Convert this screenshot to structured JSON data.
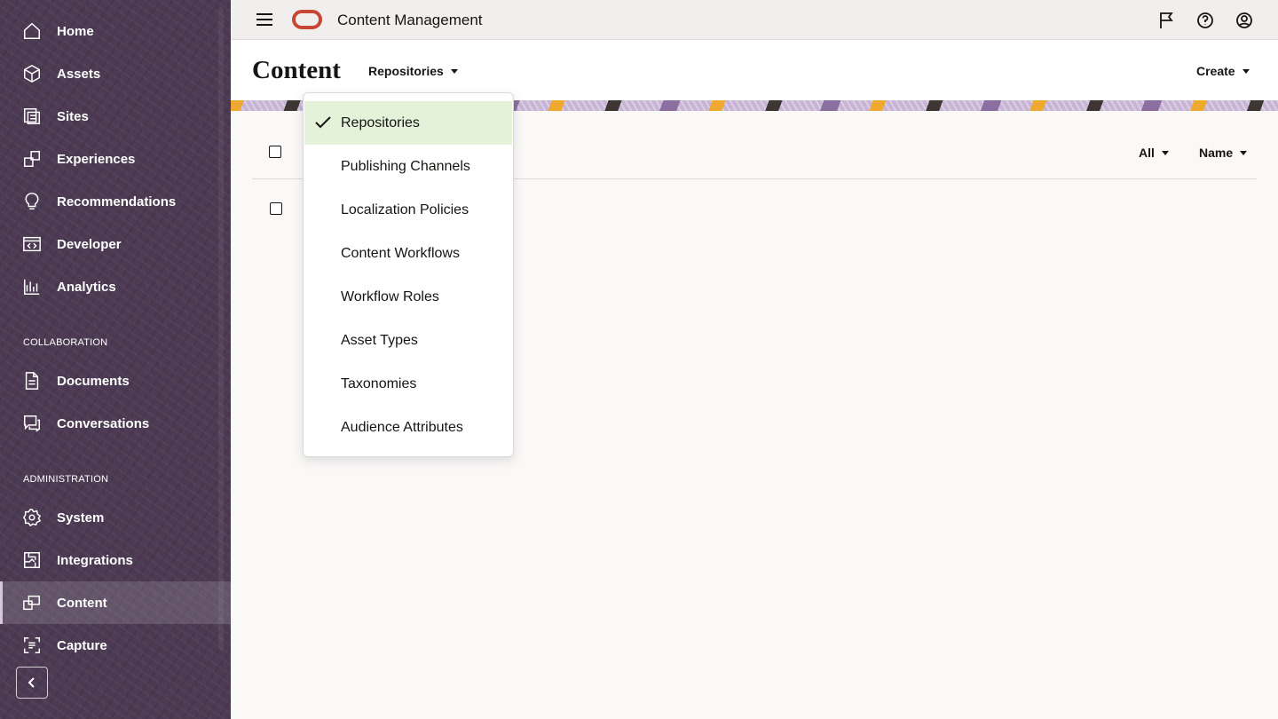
{
  "app": {
    "title": "Content Management"
  },
  "sidebar": {
    "items": [
      {
        "label": "Home",
        "icon": "home-icon"
      },
      {
        "label": "Assets",
        "icon": "cube-icon"
      },
      {
        "label": "Sites",
        "icon": "sites-icon"
      },
      {
        "label": "Experiences",
        "icon": "experiences-icon"
      },
      {
        "label": "Recommendations",
        "icon": "lightbulb-icon"
      },
      {
        "label": "Developer",
        "icon": "code-icon"
      },
      {
        "label": "Analytics",
        "icon": "chart-icon"
      }
    ],
    "collaboration_label": "COLLABORATION",
    "collaboration_items": [
      {
        "label": "Documents",
        "icon": "document-icon"
      },
      {
        "label": "Conversations",
        "icon": "conversation-icon"
      }
    ],
    "administration_label": "ADMINISTRATION",
    "administration_items": [
      {
        "label": "System",
        "icon": "gear-icon"
      },
      {
        "label": "Integrations",
        "icon": "integrations-icon"
      },
      {
        "label": "Content",
        "icon": "content-icon",
        "active": true
      },
      {
        "label": "Capture",
        "icon": "capture-icon"
      }
    ]
  },
  "page": {
    "title": "Content",
    "view_selector": "Repositories",
    "create_label": "Create",
    "filter_label": "All",
    "sort_label": "Name"
  },
  "menu": {
    "selected": "Repositories",
    "items": [
      "Repositories",
      "Publishing Channels",
      "Localization Policies",
      "Content Workflows",
      "Workflow Roles",
      "Asset Types",
      "Taxonomies",
      "Audience Attributes"
    ]
  },
  "colors": {
    "sidebar_bg": "#4b3a52",
    "logo_red": "#c74634",
    "selected_menu_bg": "#e3f2d9",
    "header_bg": "#f1efed"
  }
}
